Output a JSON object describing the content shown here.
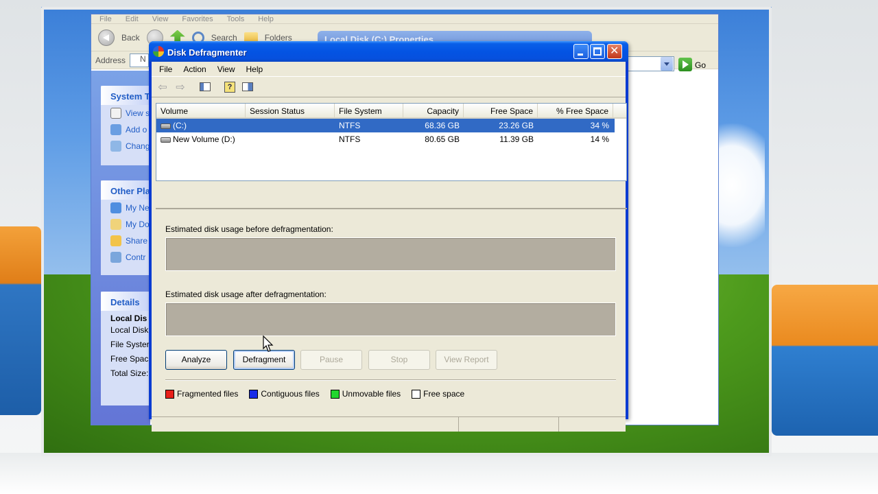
{
  "explorer": {
    "menu": [
      "File",
      "Edit",
      "View",
      "Favorites",
      "Tools",
      "Help"
    ],
    "toolbar": {
      "back_label": "Back",
      "search_label": "Search",
      "folders_label": "Folders"
    },
    "address_label": "Address",
    "address_value": "N",
    "go_label": "Go",
    "ghost_title": "Local Disk (C:) Properties",
    "system_tasks": {
      "heading": "System T",
      "items": [
        "View s",
        "Add o",
        "Chang"
      ]
    },
    "other_places": {
      "heading": "Other Pla",
      "items": [
        "My Ne",
        "My Do",
        "Share",
        "Contr"
      ]
    },
    "details": {
      "heading": "Details",
      "name": "Local Dis",
      "type": "Local Disk",
      "rows": [
        "File Syster",
        "Free Spac",
        "Total Size:"
      ]
    }
  },
  "defrag": {
    "title": "Disk Defragmenter",
    "menu": [
      "File",
      "Action",
      "View",
      "Help"
    ],
    "columns": [
      "Volume",
      "Session Status",
      "File System",
      "Capacity",
      "Free Space",
      "% Free Space"
    ],
    "volumes": [
      {
        "name": "(C:)",
        "status": "",
        "fs": "NTFS",
        "capacity": "68.36 GB",
        "free": "23.26 GB",
        "pct": "34 %",
        "selected": true
      },
      {
        "name": "New Volume (D:)",
        "status": "",
        "fs": "NTFS",
        "capacity": "80.65 GB",
        "free": "11.39 GB",
        "pct": "14 %",
        "selected": false
      }
    ],
    "before_label": "Estimated disk usage before defragmentation:",
    "after_label": "Estimated disk usage after defragmentation:",
    "buttons": {
      "analyze": "Analyze",
      "defragment": "Defragment",
      "pause": "Pause",
      "stop": "Stop",
      "view_report": "View Report"
    },
    "legend": [
      {
        "label": "Fragmented files",
        "color": "#e8201a"
      },
      {
        "label": "Contiguous files",
        "color": "#1a2de8"
      },
      {
        "label": "Unmovable files",
        "color": "#22d62e"
      },
      {
        "label": "Free space",
        "color": "#ffffff"
      }
    ]
  }
}
